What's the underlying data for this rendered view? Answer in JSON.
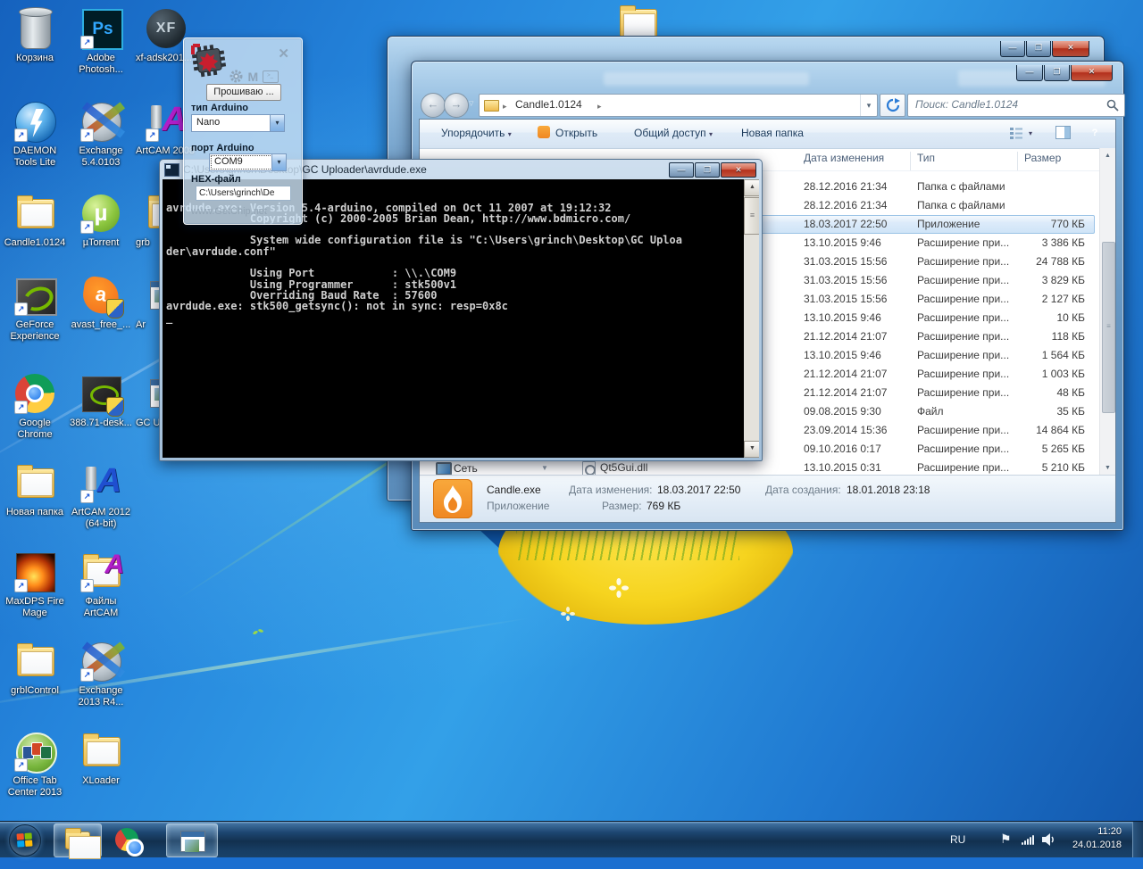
{
  "palette": {
    "accent": "#4a7dbd",
    "taskbar": "#16365c",
    "selection": "#cfe4f7",
    "close-red": "#c23b2a",
    "folder-yellow": "#f0c455",
    "flame-orange": "#f5921e",
    "console-bg": "#000000",
    "console-text": "#cfcfcf"
  },
  "glyphs": {
    "minimize": "—",
    "maximize": "❐",
    "close": "✕",
    "dropdown": "▾",
    "dropdown_open": "▽",
    "breadcrumb_sep": "▸",
    "up": "▲",
    "down": "▼",
    "back": "←",
    "forward": "→",
    "grip": "≡",
    "flag": "⚑",
    "help": "?",
    "ps": "Ps",
    "xf": "XF",
    "mu": "µ",
    "avast_a": "a",
    "letter_a": "A",
    "letter_m": "M",
    "terminal": ">_",
    "shortcut": "↗",
    "cursor": "_"
  },
  "desktop": {
    "icons": [
      {
        "label": "Корзина",
        "kind": "recycle-bin"
      },
      {
        "label": "Adobe Photosh...",
        "kind": "photoshop"
      },
      {
        "label": "xf-adsk201...",
        "kind": "xf"
      },
      {
        "label": "DAEMON Tools Lite",
        "kind": "daemon-tools"
      },
      {
        "label": "Exchange 5.4.0103",
        "kind": "exchange"
      },
      {
        "label": "ArtCAM 2008",
        "kind": "artcam"
      },
      {
        "label": "Candle1.0124",
        "kind": "folder"
      },
      {
        "label": "µTorrent",
        "kind": "utorrent"
      },
      {
        "label": "grb",
        "kind": "folder"
      },
      {
        "label": "GeForce Experience",
        "kind": "geforce"
      },
      {
        "label": "avast_free_...",
        "kind": "avast"
      },
      {
        "label": "Ar",
        "kind": "app"
      },
      {
        "label": "Google Chrome",
        "kind": "chrome"
      },
      {
        "label": "388.71-desk...",
        "kind": "nvidia"
      },
      {
        "label": "GC U",
        "kind": "app"
      },
      {
        "label": "Новая папка",
        "kind": "folder"
      },
      {
        "label": "ArtCAM 2012 (64-bit)",
        "kind": "artcam"
      },
      {
        "label": "MaxDPS Fire Mage",
        "kind": "fire"
      },
      {
        "label": "Файлы ArtCAM",
        "kind": "folder-artcam"
      },
      {
        "label": "grblControl",
        "kind": "folder"
      },
      {
        "label": "Exchange 2013 R4...",
        "kind": "exchange"
      },
      {
        "label": "Office Tab Center 2013",
        "kind": "office-tab"
      },
      {
        "label": "XLoader",
        "kind": "folder"
      }
    ]
  },
  "uploader": {
    "flash_button": "Прошиваю ...",
    "type_label": "тип Arduino",
    "type_value": "Nano",
    "port_label": "порт Arduino",
    "port_value": "COM9",
    "hex_label": "HEX-файл",
    "hex_value": "C:\\Users\\grinch\\De",
    "watermark": "www.GetChip.net"
  },
  "console": {
    "title": "C:\\Users\\grinch\\Desktop\\GC Uploader\\avrdude.exe",
    "lines": [
      "",
      "",
      "avrdude.exe: Version 5.4-arduino, compiled on Oct 11 2007 at 19:12:32",
      "             Copyright (c) 2000-2005 Brian Dean, http://www.bdmicro.com/",
      "",
      "             System wide configuration file is \"C:\\Users\\grinch\\Desktop\\GC Uploa",
      "der\\avrdude.conf\"",
      "",
      "             Using Port            : \\\\.\\COM9",
      "             Using Programmer      : stk500v1",
      "             Overriding Baud Rate  : 57600",
      "avrdude.exe: stk500_getsync(): not in sync: resp=0x8c",
      "_"
    ]
  },
  "explorer": {
    "breadcrumb": "Candle1.0124",
    "search": "Поиск: Candle1.0124",
    "toolbar": {
      "organize": "Упорядочить",
      "open": "Открыть",
      "share": "Общий доступ",
      "new_folder": "Новая папка"
    },
    "columns": [
      "Дата изменения",
      "Тип",
      "Размер"
    ],
    "selected_index": 2,
    "rows": [
      {
        "date": "28.12.2016 21:34",
        "type": "Папка с файлами",
        "size": ""
      },
      {
        "date": "28.12.2016 21:34",
        "type": "Папка с файлами",
        "size": ""
      },
      {
        "date": "18.03.2017 22:50",
        "type": "Приложение",
        "size": "770 КБ"
      },
      {
        "date": "13.10.2015 9:46",
        "type": "Расширение при...",
        "size": "3 386 КБ"
      },
      {
        "date": "31.03.2015 15:56",
        "type": "Расширение при...",
        "size": "24 788 КБ"
      },
      {
        "date": "31.03.2015 15:56",
        "type": "Расширение при...",
        "size": "3 829 КБ"
      },
      {
        "date": "31.03.2015 15:56",
        "type": "Расширение при...",
        "size": "2 127 КБ"
      },
      {
        "date": "13.10.2015 9:46",
        "type": "Расширение при...",
        "size": "10 КБ"
      },
      {
        "date": "21.12.2014 21:07",
        "type": "Расширение при...",
        "size": "118 КБ"
      },
      {
        "date": "13.10.2015 9:46",
        "type": "Расширение при...",
        "size": "1 564 КБ"
      },
      {
        "date": "21.12.2014 21:07",
        "type": "Расширение при...",
        "size": "1 003 КБ"
      },
      {
        "date": "21.12.2014 21:07",
        "type": "Расширение при...",
        "size": "48 КБ"
      },
      {
        "date": "09.08.2015 9:30",
        "type": "Файл",
        "size": "35 КБ"
      },
      {
        "date": "23.09.2014 15:36",
        "type": "Расширение при...",
        "size": "14 864 КБ"
      },
      {
        "date": "09.10.2016 0:17",
        "type": "Расширение при...",
        "size": "5 265 КБ"
      },
      {
        "date": "13.10.2015 0:31",
        "type": "Расширение при...",
        "size": "5 210 КБ"
      }
    ],
    "visible_file": "Qt5Gui.dll",
    "network": "Сеть",
    "details": {
      "name": "Candle.exe",
      "type": "Приложение",
      "modified_label": "Дата изменения:",
      "modified": "18.03.2017 22:50",
      "created_label": "Дата создания:",
      "created": "18.01.2018 23:18",
      "size_label": "Размер:",
      "size": "769 КБ"
    }
  },
  "taskbar": {
    "language": "RU",
    "time": "11:20",
    "date": "24.01.2018"
  }
}
